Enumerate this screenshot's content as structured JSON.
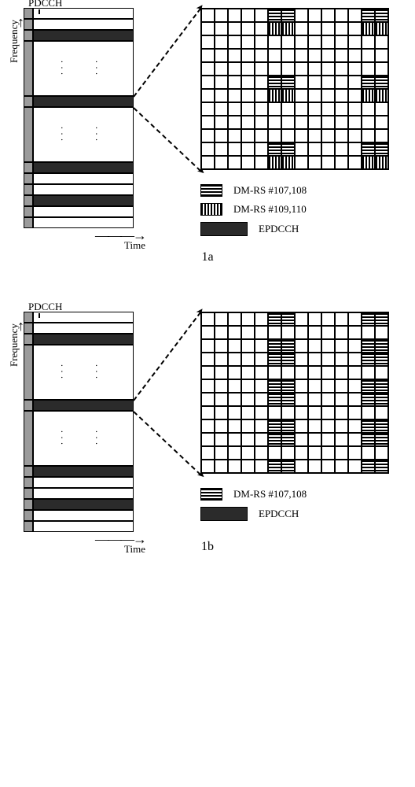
{
  "fig_a": {
    "pdcch_label": "PDCCH",
    "freq_label": "Frequency",
    "time_label": "Time",
    "caption": "1a",
    "legend": [
      {
        "style": "h-stripe",
        "label": "DM-RS #107,108"
      },
      {
        "style": "v-stripe",
        "label": "DM-RS #109,110"
      },
      {
        "style": "solid",
        "label": "EPDCCH"
      }
    ],
    "grid": {
      "rows": 12,
      "cols": 14,
      "h_stripe_cells": [
        {
          "r": 0,
          "c": 5
        },
        {
          "r": 0,
          "c": 6
        },
        {
          "r": 0,
          "c": 12
        },
        {
          "r": 0,
          "c": 13
        },
        {
          "r": 5,
          "c": 5
        },
        {
          "r": 5,
          "c": 6
        },
        {
          "r": 5,
          "c": 12
        },
        {
          "r": 5,
          "c": 13
        },
        {
          "r": 10,
          "c": 5
        },
        {
          "r": 10,
          "c": 6
        },
        {
          "r": 10,
          "c": 12
        },
        {
          "r": 10,
          "c": 13
        }
      ],
      "v_stripe_cells": [
        {
          "r": 1,
          "c": 5
        },
        {
          "r": 1,
          "c": 6
        },
        {
          "r": 1,
          "c": 12
        },
        {
          "r": 1,
          "c": 13
        },
        {
          "r": 6,
          "c": 5
        },
        {
          "r": 6,
          "c": 6
        },
        {
          "r": 6,
          "c": 12
        },
        {
          "r": 6,
          "c": 13
        },
        {
          "r": 11,
          "c": 5
        },
        {
          "r": 11,
          "c": 6
        },
        {
          "r": 11,
          "c": 12
        },
        {
          "r": 11,
          "c": 13
        }
      ]
    }
  },
  "fig_b": {
    "pdcch_label": "PDCCH",
    "freq_label": "Frequency",
    "time_label": "Time",
    "caption": "1b",
    "legend": [
      {
        "style": "h-stripe",
        "label": "DM-RS #107,108"
      },
      {
        "style": "solid",
        "label": "EPDCCH"
      }
    ],
    "grid": {
      "rows": 12,
      "cols": 14,
      "h_stripe_cells": [
        {
          "r": 0,
          "c": 5
        },
        {
          "r": 0,
          "c": 6
        },
        {
          "r": 0,
          "c": 12
        },
        {
          "r": 0,
          "c": 13
        },
        {
          "r": 2,
          "c": 5
        },
        {
          "r": 2,
          "c": 6
        },
        {
          "r": 2,
          "c": 12
        },
        {
          "r": 2,
          "c": 13
        },
        {
          "r": 3,
          "c": 5
        },
        {
          "r": 3,
          "c": 6
        },
        {
          "r": 3,
          "c": 12
        },
        {
          "r": 3,
          "c": 13
        },
        {
          "r": 5,
          "c": 5
        },
        {
          "r": 5,
          "c": 6
        },
        {
          "r": 5,
          "c": 12
        },
        {
          "r": 5,
          "c": 13
        },
        {
          "r": 6,
          "c": 5
        },
        {
          "r": 6,
          "c": 6
        },
        {
          "r": 6,
          "c": 12
        },
        {
          "r": 6,
          "c": 13
        },
        {
          "r": 8,
          "c": 5
        },
        {
          "r": 8,
          "c": 6
        },
        {
          "r": 8,
          "c": 12
        },
        {
          "r": 8,
          "c": 13
        },
        {
          "r": 9,
          "c": 5
        },
        {
          "r": 9,
          "c": 6
        },
        {
          "r": 9,
          "c": 12
        },
        {
          "r": 9,
          "c": 13
        },
        {
          "r": 11,
          "c": 5
        },
        {
          "r": 11,
          "c": 6
        },
        {
          "r": 11,
          "c": 12
        },
        {
          "r": 11,
          "c": 13
        }
      ],
      "v_stripe_cells": []
    }
  },
  "subframe_rows": [
    {
      "type": "blank"
    },
    {
      "type": "blank"
    },
    {
      "type": "epd"
    },
    {
      "type": "tall",
      "dots": true
    },
    {
      "type": "epd",
      "highlight": true
    },
    {
      "type": "tall",
      "dots": true
    },
    {
      "type": "epd"
    },
    {
      "type": "blank"
    },
    {
      "type": "blank"
    },
    {
      "type": "epd"
    },
    {
      "type": "blank"
    },
    {
      "type": "blank"
    }
  ]
}
